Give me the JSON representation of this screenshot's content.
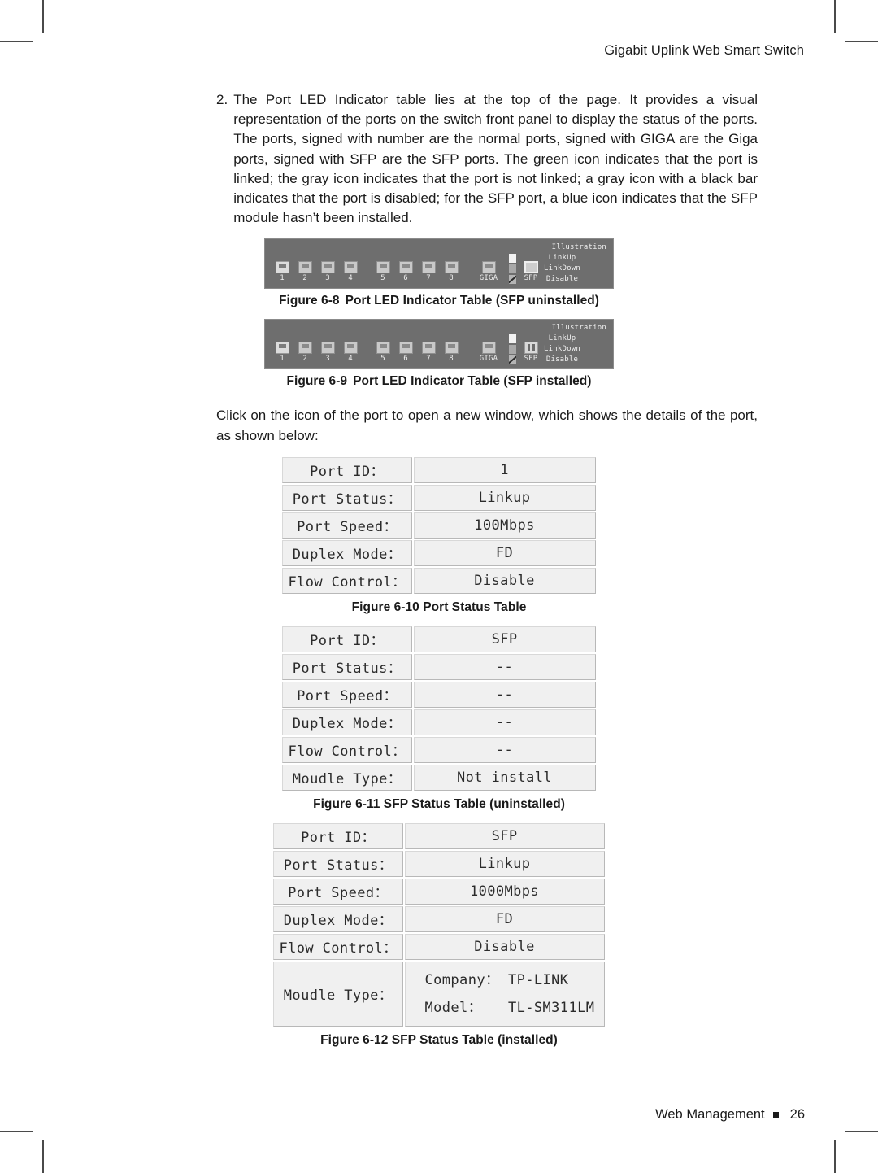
{
  "header": {
    "running_head": "Gigabit Uplink Web Smart Switch"
  },
  "body": {
    "item_number": "2.",
    "item_text": "The Port LED Indicator table lies at the top of the page. It provides a visual representation of the ports on the switch front panel to display the status of the ports. The ports, signed with number are the normal ports, signed with GIGA are the Giga ports, signed with SFP are the SFP ports. The green icon indicates that the port is linked; the gray icon indicates that the port is not linked; a gray icon with a black bar indicates that the port is disabled; for the SFP port, a blue icon indicates that the SFP module hasn’t been installed.",
    "click_paragraph": "Click on the icon of the port to open a new window, which shows the details of the port, as shown below:"
  },
  "led_panel": {
    "legend_title": "Illustration",
    "legend": [
      {
        "label": "LinkUp"
      },
      {
        "label": "LinkDown"
      },
      {
        "label": "Disable"
      }
    ],
    "ports": [
      "1",
      "2",
      "3",
      "4",
      "5",
      "6",
      "7",
      "8",
      "GIGA",
      "SFP"
    ]
  },
  "figures": {
    "fig_6_8": {
      "number": "Figure 6-8",
      "title": "Port LED Indicator Table (SFP uninstalled)"
    },
    "fig_6_9": {
      "number": "Figure 6-9",
      "title": "Port LED Indicator Table (SFP installed)"
    },
    "fig_6_10": {
      "caption": "Figure 6-10 Port Status Table"
    },
    "fig_6_11": {
      "caption": "Figure 6-11 SFP Status Table (uninstalled)"
    },
    "fig_6_12": {
      "caption": "Figure 6-12 SFP Status Table (installed)"
    }
  },
  "port_status_table": {
    "rows": [
      {
        "key": "Port ID：",
        "value": "1"
      },
      {
        "key": "Port Status：",
        "value": "Linkup"
      },
      {
        "key": "Port Speed：",
        "value": "100Mbps"
      },
      {
        "key": "Duplex Mode：",
        "value": "FD"
      },
      {
        "key": "Flow Control：",
        "value": "Disable"
      }
    ]
  },
  "sfp_status_uninstalled": {
    "rows": [
      {
        "key": "Port ID：",
        "value": "SFP"
      },
      {
        "key": "Port Status：",
        "value": "--"
      },
      {
        "key": "Port Speed：",
        "value": "--"
      },
      {
        "key": "Duplex Mode：",
        "value": "--"
      },
      {
        "key": "Flow Control：",
        "value": "--"
      },
      {
        "key": "Moudle Type：",
        "value": "Not install"
      }
    ]
  },
  "sfp_status_installed": {
    "rows": [
      {
        "key": "Port ID：",
        "value": "SFP"
      },
      {
        "key": "Port Status：",
        "value": "Linkup"
      },
      {
        "key": "Port Speed：",
        "value": "1000Mbps"
      },
      {
        "key": "Duplex Mode：",
        "value": "FD"
      },
      {
        "key": "Flow Control：",
        "value": "Disable"
      }
    ],
    "module_row": {
      "key": "Moudle Type：",
      "company_line": "Company： TP-LINK",
      "model_line": "Model：   TL-SM311LM"
    }
  },
  "footer": {
    "section": "Web Management",
    "page_number": "26"
  },
  "colors": {
    "panel_bg": "#6e6e6e",
    "cell_bg": "#f0f0f0",
    "text": "#1a1a1a"
  }
}
